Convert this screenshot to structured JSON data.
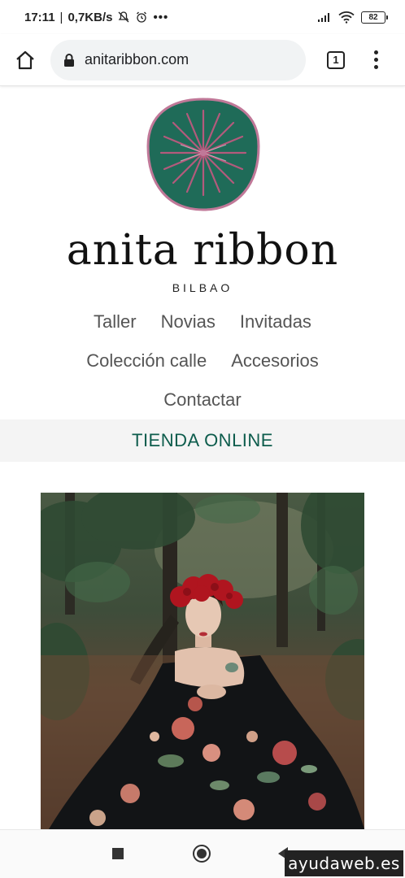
{
  "status_bar": {
    "time": "17:11",
    "speed": "0,7KB/s",
    "battery": "82"
  },
  "browser": {
    "url": "anitaribbon.com",
    "tab_count": "1"
  },
  "site": {
    "brand_name": "anita ribbon",
    "brand_city": "BILBAO",
    "nav": [
      [
        "Taller",
        "Novias",
        "Invitadas"
      ],
      [
        "Colección calle",
        "Accesorios"
      ],
      [
        "Contactar"
      ]
    ],
    "shop_link": "TIENDA ONLINE"
  },
  "watermark": "ayudaweb.es",
  "colors": {
    "logo_green": "#1f6b58",
    "logo_pink": "#c07898",
    "shop_text": "#0d5c4c"
  }
}
